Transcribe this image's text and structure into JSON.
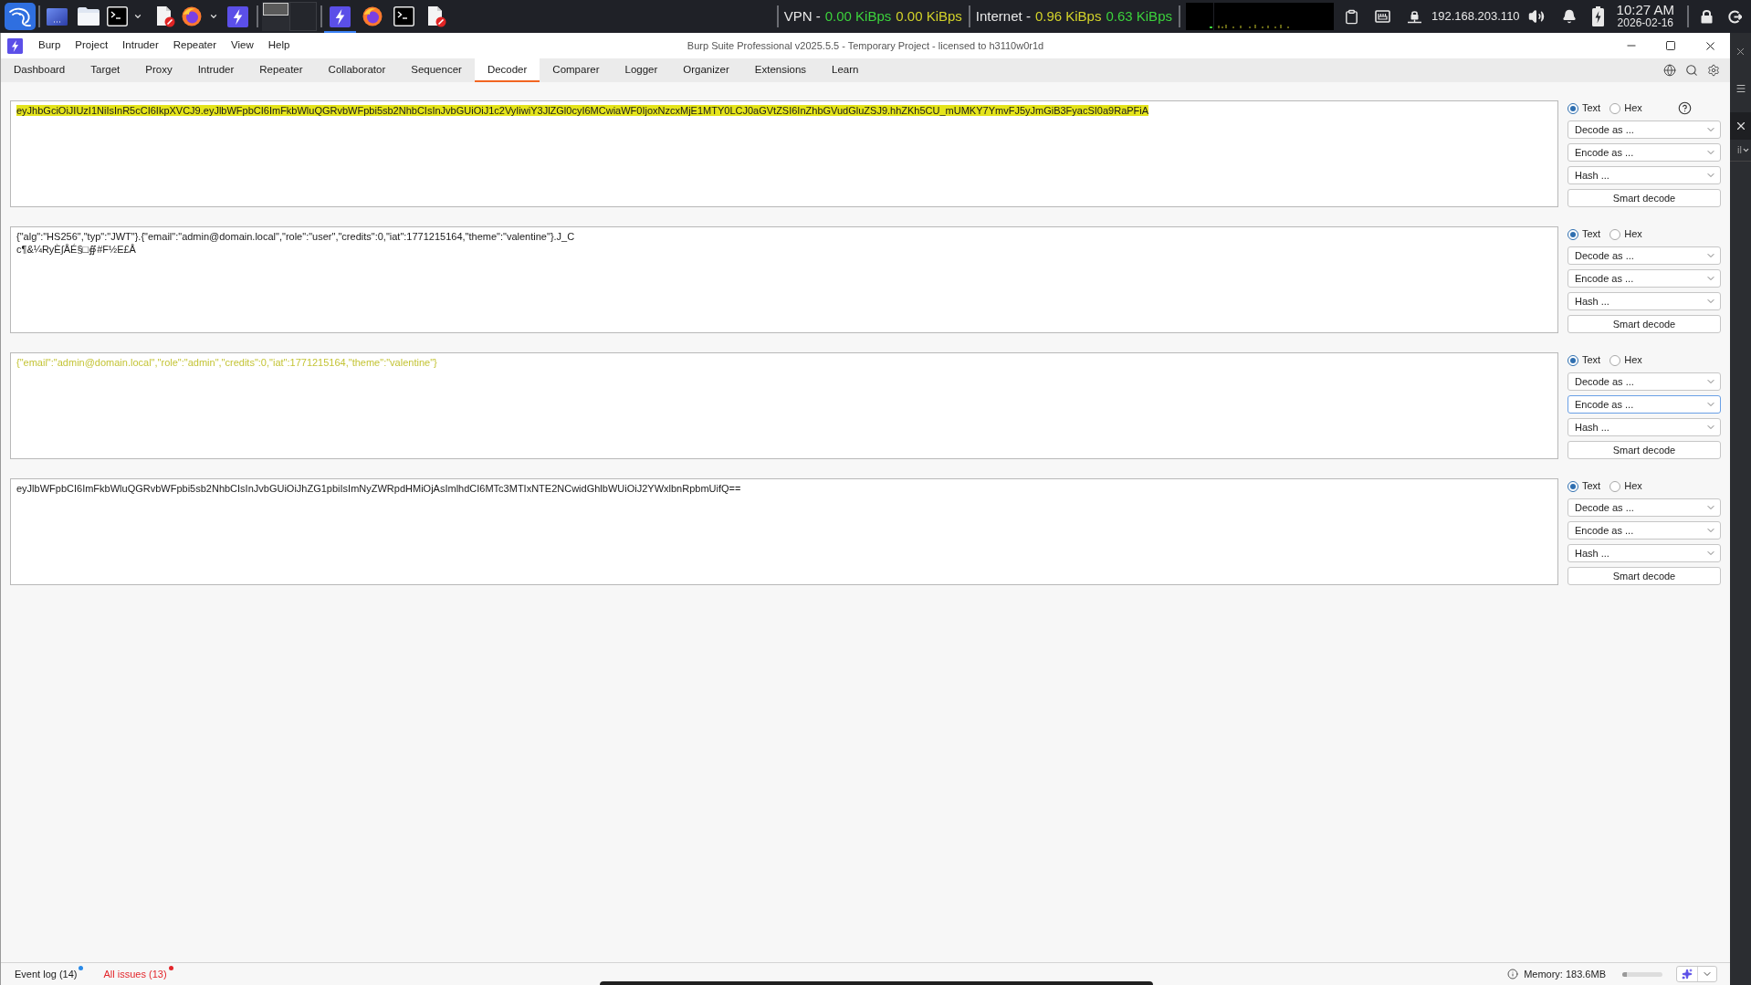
{
  "taskbar": {
    "workspaces": [
      {
        "selected": true
      },
      {
        "selected": false
      }
    ],
    "running_apps": [
      {
        "kind": "burp",
        "selected": true
      },
      {
        "kind": "firefox",
        "selected": false
      },
      {
        "kind": "terminal",
        "selected": false
      },
      {
        "kind": "editor",
        "selected": false
      }
    ],
    "network": [
      {
        "label": "VPN -",
        "readings": [
          {
            "text": "0.00 KiBps",
            "color": "#3cd23c"
          },
          {
            "text": "0.00 KiBps",
            "color": "#d2d22a"
          }
        ]
      },
      {
        "label": "Internet -",
        "readings": [
          {
            "text": "0.96 KiBps",
            "color": "#d2d22a"
          },
          {
            "text": "0.63 KiBps",
            "color": "#3cd23c"
          }
        ]
      }
    ],
    "ip_address": "192.168.203.110",
    "clock": {
      "time": "10:27 AM",
      "date": "2026-02-16"
    }
  },
  "window": {
    "title": "Burp Suite Professional v2025.5.5 - Temporary Project - licensed to h3110w0r1d",
    "menu": [
      "Burp",
      "Project",
      "Intruder",
      "Repeater",
      "View",
      "Help"
    ]
  },
  "tabs": [
    {
      "label": "Dashboard",
      "selected": false
    },
    {
      "label": "Target",
      "selected": false
    },
    {
      "label": "Proxy",
      "selected": false
    },
    {
      "label": "Intruder",
      "selected": false
    },
    {
      "label": "Repeater",
      "selected": false
    },
    {
      "label": "Collaborator",
      "selected": false
    },
    {
      "label": "Sequencer",
      "selected": false
    },
    {
      "label": "Decoder",
      "selected": true
    },
    {
      "label": "Comparer",
      "selected": false
    },
    {
      "label": "Logger",
      "selected": false
    },
    {
      "label": "Organizer",
      "selected": false
    },
    {
      "label": "Extensions",
      "selected": false
    },
    {
      "label": "Learn",
      "selected": false
    }
  ],
  "panels": [
    {
      "lines": [
        "eyJhbGciOiJIUzI1NiIsInR5cCI6IkpXVCJ9.eyJlbWFpbCI6ImFkbWluQGRvbWFpbi5sb2NhbCIsInJvbGUiOiJ1c2VyIiwiY3JlZGl0cyI6MCwiaWF0IjoxNzcxMjE1MTY0LCJ0aGVtZSI6InZhbGVudGluZSJ9.hhZKh5CU_mUMKY7YmvFJ5yJmGiB3FyacSI0a9RaPFiA"
      ],
      "highlighted": true,
      "modes": [
        {
          "label": "Text",
          "selected": true
        },
        {
          "label": "Hex",
          "selected": false
        }
      ],
      "help": true,
      "dropdowns": [
        {
          "label": "Decode as ...",
          "focused": false
        },
        {
          "label": "Encode as ...",
          "focused": false
        },
        {
          "label": "Hash ...",
          "focused": false
        }
      ],
      "button": "Smart decode"
    },
    {
      "lines": [
        "{\"alg\":\"HS256\",\"typ\":\"JWT\"}.{\"email\":\"admin@domain.local\",\"role\":\"user\",\"credits\":0,\"iat\":1771215164,\"theme\":\"valentine\"}.J_C",
        "c¶&¼RyÈ∫ÅÉ§□∯#F½E£Å"
      ],
      "highlighted": false,
      "modes": [
        {
          "label": "Text",
          "selected": true
        },
        {
          "label": "Hex",
          "selected": false
        }
      ],
      "dropdowns": [
        {
          "label": "Decode as ...",
          "focused": false
        },
        {
          "label": "Encode as ...",
          "focused": false
        },
        {
          "label": "Hash ...",
          "focused": false
        }
      ],
      "button": "Smart decode"
    },
    {
      "lines": [
        "{\"email\":\"admin@domain.local\",\"role\":\"admin\",\"credits\":0,\"iat\":1771215164,\"theme\":\"valentine\"}"
      ],
      "highlighted": false,
      "color": "#c4c436",
      "modes": [
        {
          "label": "Text",
          "selected": true
        },
        {
          "label": "Hex",
          "selected": false
        }
      ],
      "dropdowns": [
        {
          "label": "Decode as ...",
          "focused": false
        },
        {
          "label": "Encode as ...",
          "focused": true
        },
        {
          "label": "Hash ...",
          "focused": false
        }
      ],
      "button": "Smart decode"
    },
    {
      "lines": [
        "eyJlbWFpbCI6ImFkbWluQGRvbWFpbi5sb2NhbCIsInJvbGUiOiJhZG1pbiIsImNyZWRpdHMiOjAsImlhdCI6MTc3MTIxNTE2NCwidGhlbWUiOiJ2YWxlbnRpbmUifQ=="
      ],
      "highlighted": false,
      "modes": [
        {
          "label": "Text",
          "selected": true
        },
        {
          "label": "Hex",
          "selected": false
        }
      ],
      "dropdowns": [
        {
          "label": "Decode as ...",
          "focused": false
        },
        {
          "label": "Encode as ...",
          "focused": false
        },
        {
          "label": "Hash ...",
          "focused": false
        }
      ],
      "button": "Smart decode"
    }
  ],
  "status_bar": {
    "items": [
      {
        "label": "Event log (14)",
        "kind": "plain",
        "color": "#2a8ae8"
      },
      {
        "label": "All issues (13)",
        "kind": "alert",
        "color": "#e3262b"
      }
    ],
    "memory": {
      "label": "Memory: 183.6MB",
      "level": 0.12
    }
  },
  "background_window": {
    "text": "il"
  }
}
